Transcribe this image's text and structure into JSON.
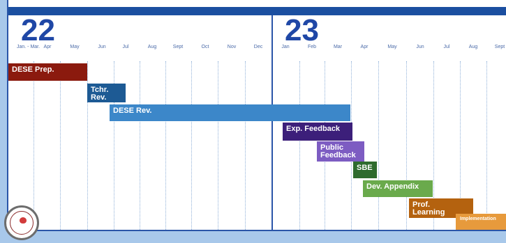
{
  "years": [
    "22",
    "23"
  ],
  "months_2022": [
    "Jan. -\nMar.",
    "Apr",
    "May",
    "Jun",
    "Jul",
    "Aug",
    "Sept",
    "Oct",
    "Nov",
    "Dec"
  ],
  "months_2023": [
    "Jan",
    "Feb",
    "Mar",
    "Apr",
    "May",
    "Jun",
    "Jul",
    "Aug",
    "Sept"
  ],
  "tasks": [
    {
      "id": "dese-prep",
      "label": "DESE Prep.",
      "color": "#8b1a0e"
    },
    {
      "id": "tchr-rev",
      "label": "Tchr.\nRev.",
      "color": "#1d5a94"
    },
    {
      "id": "dese-rev",
      "label": "DESE Rev.",
      "color": "#3c87c9"
    },
    {
      "id": "exp-feedback",
      "label": "Exp. Feedback",
      "color": "#3c1f7a"
    },
    {
      "id": "public-feedback",
      "label": "Public\nFeedback",
      "color": "#7d5cc2"
    },
    {
      "id": "sbe",
      "label": "SBE",
      "color": "#2e6b2e"
    },
    {
      "id": "dev-appendix",
      "label": "Dev. Appendix",
      "color": "#6aaa4c"
    },
    {
      "id": "prof-learning",
      "label": "Prof.\nLearning",
      "color": "#b4620f"
    },
    {
      "id": "implementation",
      "label": "Implementation",
      "color": "#e79a3c"
    }
  ]
}
